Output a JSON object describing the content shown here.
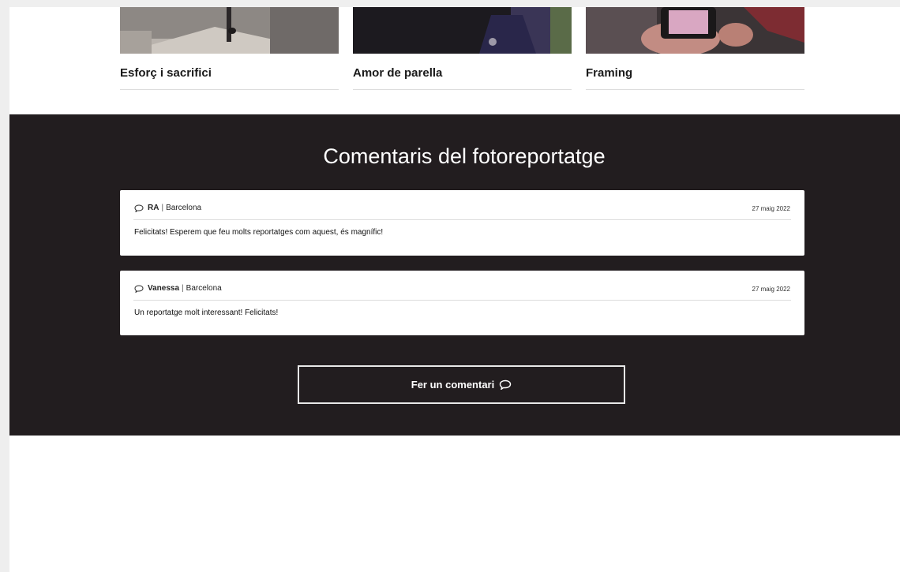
{
  "related": {
    "cards": [
      {
        "title": "Esforç i sacrifici"
      },
      {
        "title": "Amor de parella"
      },
      {
        "title": "Framing"
      }
    ]
  },
  "comments": {
    "heading": "Comentaris del fotoreportatge",
    "items": [
      {
        "author": "RA",
        "separator": "|",
        "location": "Barcelona",
        "date": "27 maig 2022",
        "text": "Felicitats! Esperem que feu molts reportatges com aquest, és magnífic!"
      },
      {
        "author": "Vanessa",
        "separator": "|",
        "location": "Barcelona",
        "date": "27 maig 2022",
        "text": "Un reportatge molt interessant! Felicitats!"
      }
    ],
    "add_button_label": "Fer un comentari",
    "icons": {
      "comment": "speech-bubble-icon"
    },
    "colors": {
      "section_background": "#221d1f",
      "card_background": "#ffffff",
      "button_border": "#e8e8e8"
    }
  }
}
